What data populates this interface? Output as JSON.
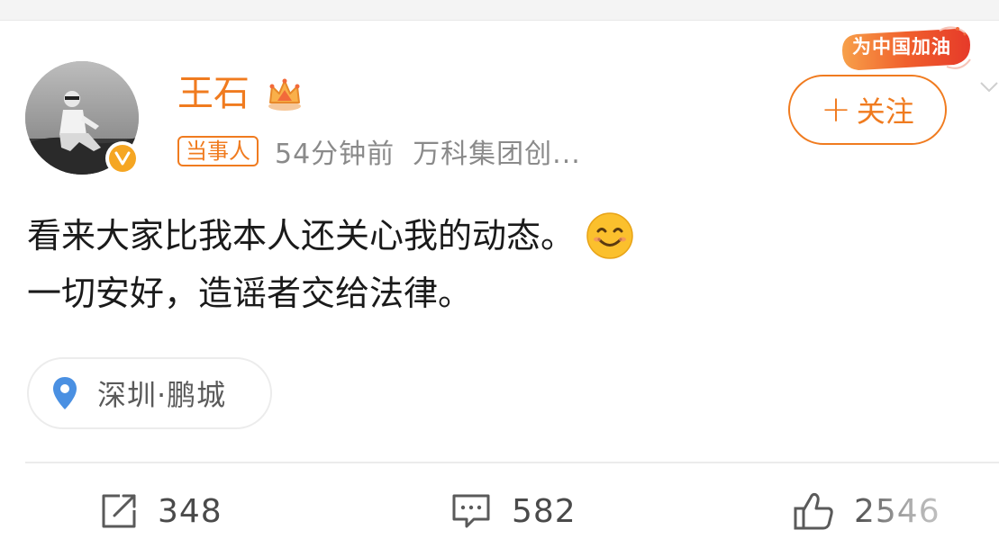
{
  "user": {
    "name": "王石",
    "tag": "当事人",
    "time": "54分钟前",
    "source": "万科集团创..."
  },
  "promo": {
    "text": "为中国加油"
  },
  "follow": {
    "plus": "+",
    "label": "关注"
  },
  "post": {
    "line1": "看来大家比我本人还关心我的动态。",
    "line2": "一切安好，造谣者交给法律。"
  },
  "location": {
    "label": "深圳·鹏城"
  },
  "actions": {
    "repost_count": "348",
    "comment_count": "582",
    "like_count": "2546"
  },
  "colors": {
    "accent": "#f07b1f",
    "meta_text": "#8a8a8a",
    "body_text": "#1a1a1a",
    "location_pin": "#4a90e2",
    "verified": "#f5a623"
  },
  "icons": {
    "avatar": "avatar-photo",
    "verified": "verified-v-icon",
    "crown": "crown-icon",
    "emoji": "smile-emoji-icon",
    "location": "location-pin-icon",
    "repost": "repost-icon",
    "comment": "comment-icon",
    "like": "thumbs-up-icon",
    "more": "chevron-down-icon"
  }
}
